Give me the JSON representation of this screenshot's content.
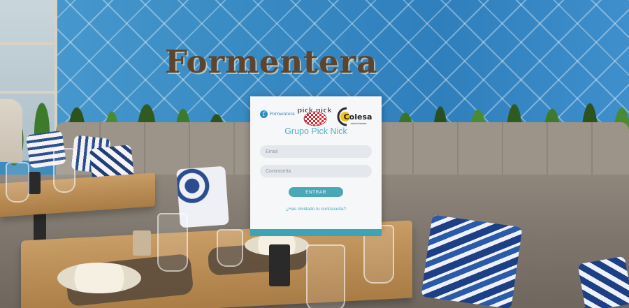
{
  "background": {
    "restaurant_sign": "Formentera",
    "tile_color": "#3d8cbd"
  },
  "login_card": {
    "logos": {
      "formentera": {
        "mark": "f",
        "text": "Formentera"
      },
      "picknick": "pick nick",
      "colesa": {
        "name": "Colesa",
        "tagline": "colectividades"
      }
    },
    "title": "Grupo Pick Nick",
    "email_placeholder": "Email",
    "password_placeholder": "Contraseña",
    "submit_label": "ENTRAR",
    "forgot_link": "¿Has olvidado tu contraseña?"
  },
  "colors": {
    "accent": "#4aa7b7",
    "title": "#4fb3c4",
    "card_bg": "#f6f7f9",
    "input_bg": "#e4e7ec",
    "bottom_bar": "#3ea3b5"
  }
}
